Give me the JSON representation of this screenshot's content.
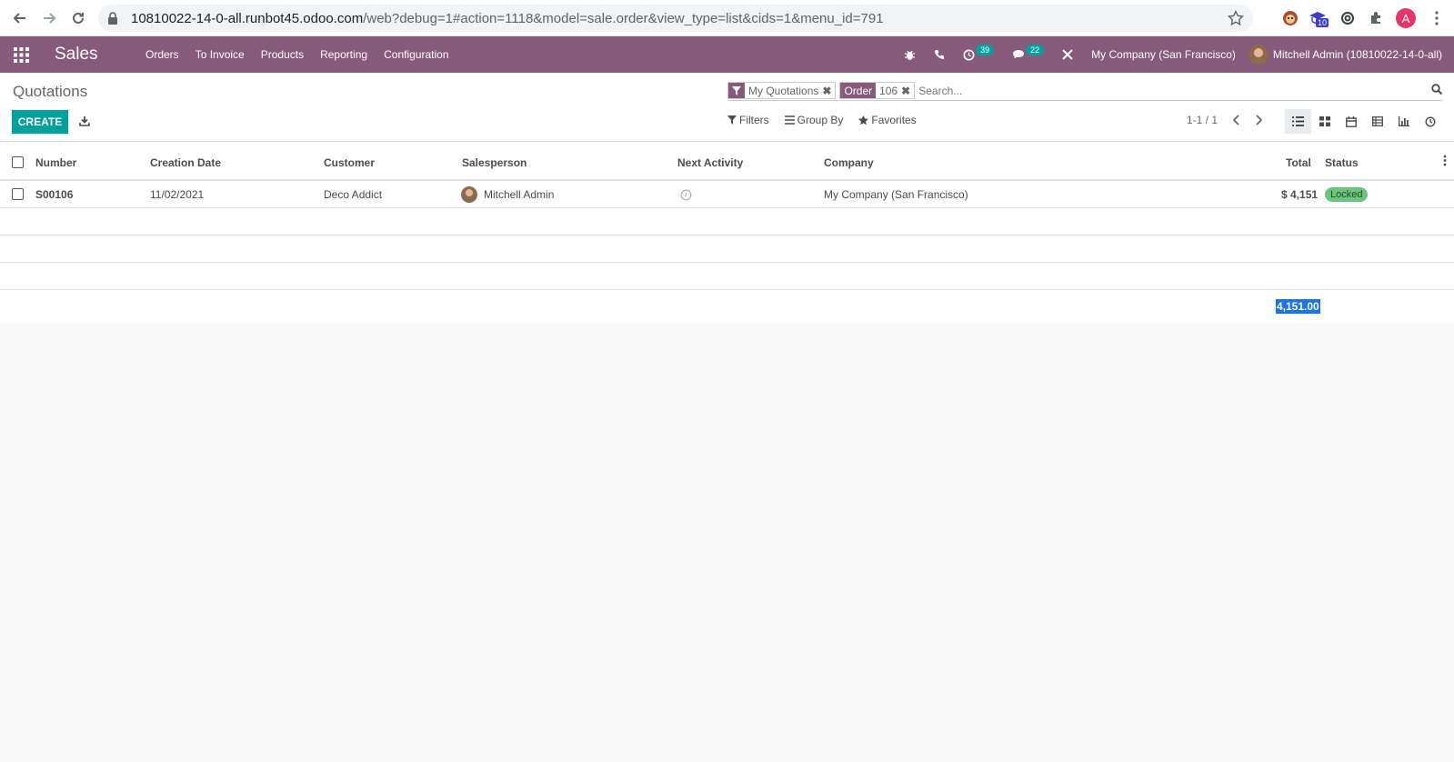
{
  "browser": {
    "url_host": "10810022-14-0-all.runbot45.odoo.com",
    "url_path": "/web?debug=1#action=1118&model=sale.order&view_type=list&cids=1&menu_id=791",
    "ext_badge": "10",
    "profile_letter": "A"
  },
  "navbar": {
    "brand": "Sales",
    "menu": [
      "Orders",
      "To Invoice",
      "Products",
      "Reporting",
      "Configuration"
    ],
    "activity_count": "39",
    "message_count": "22",
    "company": "My Company (San Francisco)",
    "user": "Mitchell Admin (10810022-14-0-all)"
  },
  "control": {
    "breadcrumb": "Quotations",
    "create_label": "CREATE",
    "facets": [
      {
        "label": "My Quotations"
      },
      {
        "label": "Order",
        "value": "106"
      }
    ],
    "search_placeholder": "Search...",
    "filters_label": "Filters",
    "groupby_label": "Group By",
    "favorites_label": "Favorites",
    "pager": "1-1 / 1"
  },
  "table": {
    "columns": [
      "Number",
      "Creation Date",
      "Customer",
      "Salesperson",
      "Next Activity",
      "Company",
      "Total",
      "Status"
    ],
    "rows": [
      {
        "number": "S00106",
        "date": "11/02/2021",
        "customer": "Deco Addict",
        "salesperson": "Mitchell Admin",
        "company": "My Company (San Francisco)",
        "total": "$ 4,151",
        "status": "Locked"
      }
    ],
    "sum_total": "4,151.00"
  },
  "colors": {
    "navbar": "#875a7b",
    "primary": "#00a09d",
    "status_locked": "#6dc47e"
  }
}
